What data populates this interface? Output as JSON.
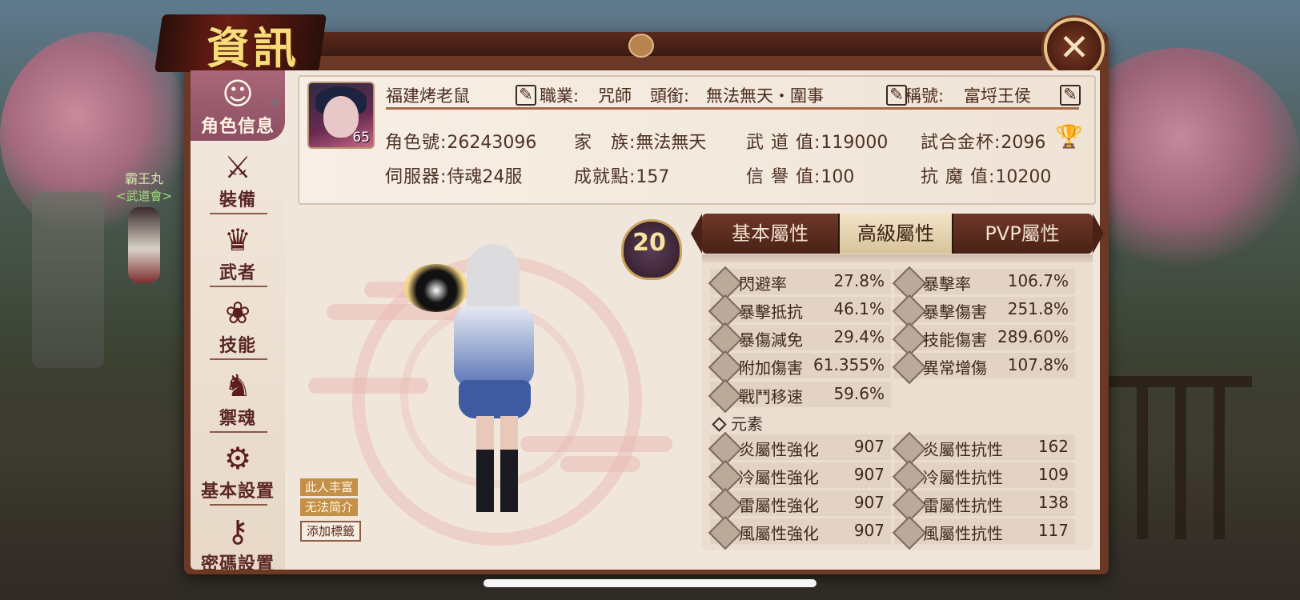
{
  "window": {
    "title": "資訊",
    "close_icon": "close-icon"
  },
  "npc": {
    "name": "霸王丸",
    "guild": "<武道會>"
  },
  "sidebar": {
    "items": [
      {
        "label": "角色信息",
        "icon": "character-icon",
        "active": true
      },
      {
        "label": "裝備",
        "icon": "swords-icon"
      },
      {
        "label": "武者",
        "icon": "samurai-helmet-icon"
      },
      {
        "label": "技能",
        "icon": "swirl-icon"
      },
      {
        "label": "禦魂",
        "icon": "spirit-icon"
      },
      {
        "label": "基本設置",
        "icon": "gear-icon"
      },
      {
        "label": "密碼設置",
        "icon": "key-icon"
      }
    ]
  },
  "profile": {
    "name": "福建烤老鼠",
    "level": "65",
    "job_label": "職業:",
    "job": "咒師",
    "rank_label": "頭銜:",
    "rank": "無法無天・圍事",
    "title_label": "稱號:",
    "title": "富埒王侯",
    "char_id_label": "角色號:",
    "char_id": "26243096",
    "server_label": "伺服器:",
    "server": "侍魂24服",
    "family_label": "家　族:",
    "family": "無法無天",
    "achievement_label": "成就點:",
    "achievement": "157",
    "martial_label": "武 道 值:",
    "martial": "119000",
    "reputation_label": "信 譽 值:",
    "reputation": "100",
    "cup_label": "試合金杯:",
    "cup": "2096",
    "anti_demon_label": "抗 魔 值:",
    "anti_demon": "10200"
  },
  "tags": {
    "rich": "此人丰富",
    "intro": "无法简介",
    "add": "添加標籤"
  },
  "rank_badge": "20",
  "tabs": [
    {
      "label": "基本屬性"
    },
    {
      "label": "高級屬性",
      "active": true
    },
    {
      "label": "PVP屬性"
    }
  ],
  "attributes": {
    "rows": [
      [
        {
          "name": "閃避率",
          "value": "27.8%"
        },
        {
          "name": "暴擊率",
          "value": "106.7%"
        }
      ],
      [
        {
          "name": "暴擊抵抗",
          "value": "46.1%"
        },
        {
          "name": "暴擊傷害",
          "value": "251.8%"
        }
      ],
      [
        {
          "name": "暴傷減免",
          "value": "29.4%"
        },
        {
          "name": "技能傷害",
          "value": "289.60%"
        }
      ],
      [
        {
          "name": "附加傷害",
          "value": "61.355%"
        },
        {
          "name": "異常增傷",
          "value": "107.8%"
        }
      ],
      [
        {
          "name": "戰鬥移速",
          "value": "59.6%"
        }
      ]
    ],
    "element_title": "元素",
    "element_rows": [
      [
        {
          "name": "炎屬性強化",
          "value": "907"
        },
        {
          "name": "炎屬性抗性",
          "value": "162"
        }
      ],
      [
        {
          "name": "冷屬性強化",
          "value": "907"
        },
        {
          "name": "冷屬性抗性",
          "value": "109"
        }
      ],
      [
        {
          "name": "雷屬性強化",
          "value": "907"
        },
        {
          "name": "雷屬性抗性",
          "value": "138"
        }
      ],
      [
        {
          "name": "風屬性強化",
          "value": "907"
        },
        {
          "name": "風屬性抗性",
          "value": "117"
        }
      ]
    ]
  },
  "colors": {
    "frame": "#6b3826",
    "accent_gold": "#f6dc7a",
    "panel": "#f1e6dc"
  }
}
